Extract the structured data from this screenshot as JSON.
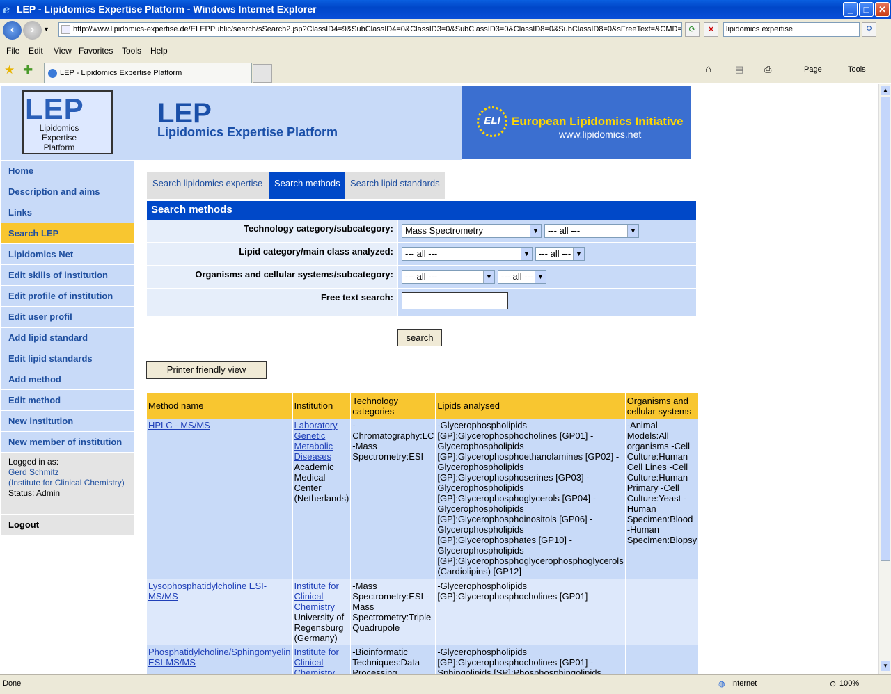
{
  "browser": {
    "title": "LEP - Lipidomics Expertise Platform - Windows Internet Explorer",
    "url": "http://www.lipidomics-expertise.de/ELEPPublic/search/sSearch2.jsp?ClassID4=9&SubClassID4=0&ClassID3=0&SubClassID3=0&ClassID8=0&SubClassID8=0&sFreeText=&CMD=",
    "search_value": "lipidomics expertise",
    "menu": [
      "File",
      "Edit",
      "View",
      "Favorites",
      "Tools",
      "Help"
    ],
    "tab_title": "LEP - Lipidomics Expertise Platform",
    "toolbar": {
      "page": "Page",
      "tools": "Tools"
    },
    "status": {
      "left": "Done",
      "zone": "Internet",
      "zoom": "100%"
    }
  },
  "logo": {
    "big": "LEP",
    "line1": "Lipidomics",
    "line2": "Expertise",
    "line3": "Platform"
  },
  "banner": {
    "title": "LEP",
    "subtitle": "Lipidomics Expertise Platform"
  },
  "eli": {
    "badge": "ELI",
    "title": "European Lipidomics Initiative",
    "url": "www.lipidomics.net"
  },
  "sidebar": {
    "items": [
      {
        "label": "Home"
      },
      {
        "label": "Description and aims"
      },
      {
        "label": "Links"
      },
      {
        "label": "Search LEP"
      },
      {
        "label": "Lipidomics Net"
      },
      {
        "label": "Edit skills of institution"
      },
      {
        "label": "Edit profile of institution"
      },
      {
        "label": "Edit user profil"
      },
      {
        "label": "Add lipid standard"
      },
      {
        "label": "Edit lipid standards"
      },
      {
        "label": "Add method"
      },
      {
        "label": "Edit method"
      },
      {
        "label": "New institution"
      },
      {
        "label": "New member of institution"
      }
    ],
    "login": {
      "label": "Logged in as:",
      "user": "Gerd Schmitz",
      "inst": "(Institute for Clinical Chemistry)",
      "status": "Status: Admin"
    },
    "logout": "Logout"
  },
  "search_tabs": [
    "Search lipidomics expertise",
    "Search methods",
    "Search lipid standards"
  ],
  "form": {
    "header": "Search methods",
    "tech_label": "Technology category/subcategory:",
    "tech_value": "Mass Spectrometry",
    "tech_sub": "--- all ---",
    "lipid_label": "Lipid category/main class analyzed:",
    "lipid_value": "--- all ---",
    "lipid_sub": "--- all ---",
    "org_label": "Organisms and cellular systems/subcategory:",
    "org_value": "--- all ---",
    "org_sub": "--- all ---",
    "free_label": "Free text search:",
    "free_value": "",
    "search_btn": "search",
    "printer_btn": "Printer friendly view"
  },
  "results": {
    "headers": [
      "Method name",
      "Institution",
      "Technology categories",
      "Lipids analysed",
      "Organisms and cellular systems"
    ],
    "rows": [
      {
        "method": "HPLC - MS/MS",
        "inst_link": "Laboratory Genetic Metabolic Diseases",
        "inst_text": "Academic Medical Center (Netherlands)",
        "tech": "-Chromatography:LC -Mass Spectrometry:ESI",
        "lipids": "-Glycerophospholipids [GP]:Glycerophosphocholines [GP01] -Glycerophospholipids [GP]:Glycerophosphoethanolamines [GP02] -Glycerophospholipids [GP]:Glycerophosphoserines [GP03] -Glycerophospholipids [GP]:Glycerophosphoglycerols [GP04] -Glycerophospholipids [GP]:Glycerophosphoinositols [GP06] -Glycerophospholipids [GP]:Glycerophosphates [GP10] -Glycerophospholipids [GP]:Glycerophosphoglycerophosphoglycerols (Cardiolipins) [GP12]",
        "orgs": "-Animal Models:All organisms -Cell Culture:Human Cell Lines -Cell Culture:Human Primary -Cell Culture:Yeast -Human Specimen:Blood -Human Specimen:Biopsy"
      },
      {
        "method": "Lysophosphatidylcholine ESI-MS/MS",
        "inst_link": "Institute for Clinical Chemistry",
        "inst_text": "University of Regensburg (Germany)",
        "tech": "-Mass Spectrometry:ESI -Mass Spectrometry:Triple Quadrupole",
        "lipids": "-Glycerophospholipids [GP]:Glycerophosphocholines [GP01]",
        "orgs": ""
      },
      {
        "method": "Phosphatidylcholine/Sphingomyelin ESI-MS/MS",
        "inst_link": "Institute for Clinical Chemistry",
        "inst_text": "",
        "tech": "-Bioinformatic Techniques:Data Processing",
        "lipids": "-Glycerophospholipids [GP]:Glycerophosphocholines [GP01] -Sphingolipids [SP]:Phosphosphingolipids",
        "orgs": ""
      }
    ]
  }
}
